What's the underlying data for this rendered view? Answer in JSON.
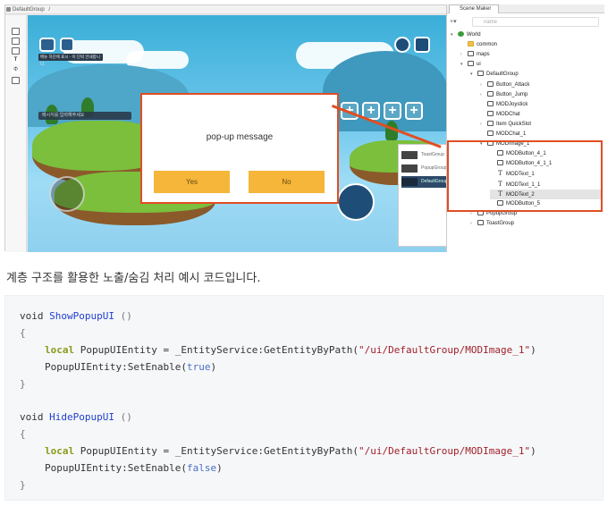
{
  "editor": {
    "tab_title": "DefaultGroup",
    "tab_separator": "/",
    "tool_icons": [
      "select-icon",
      "ui-frame-icon",
      "image-icon",
      "text-icon",
      "joystick-icon",
      "grid-icon"
    ],
    "tool_glyphs": {
      "text": "T",
      "joystick": "Φ"
    }
  },
  "game": {
    "tip_text": "메뉴 하단에 표시 - 이 단락 안내합니다.",
    "chat_placeholder": "메시지를 입력해주세요",
    "popup": {
      "message": "pop-up message",
      "yes_label": "Yes",
      "no_label": "No"
    },
    "plus_glyph": "+",
    "toast_panel": [
      {
        "label": "ToastGroup"
      },
      {
        "label": "PopupGroup"
      },
      {
        "label": "DefaultGroup"
      }
    ]
  },
  "scene_maker": {
    "title": "Scene Maker",
    "search_placeholder": "name",
    "tree": [
      {
        "label": "World",
        "depth": 0,
        "arrow": "▾",
        "icon": "world"
      },
      {
        "label": "common",
        "depth": 1,
        "arrow": "",
        "icon": "folder"
      },
      {
        "label": "maps",
        "depth": 1,
        "arrow": "›",
        "icon": "maps"
      },
      {
        "label": "ui",
        "depth": 1,
        "arrow": "▾",
        "icon": "ui"
      },
      {
        "label": "DefaultGroup",
        "depth": 2,
        "arrow": "▾",
        "icon": "group"
      },
      {
        "label": "Button_Attack",
        "depth": 3,
        "arrow": "›",
        "icon": "box"
      },
      {
        "label": "Button_Jump",
        "depth": 3,
        "arrow": "›",
        "icon": "box"
      },
      {
        "label": "MODJoystick",
        "depth": 3,
        "arrow": "",
        "icon": "box"
      },
      {
        "label": "MODChat",
        "depth": 3,
        "arrow": "",
        "icon": "box"
      },
      {
        "label": "Item QuickSlot",
        "depth": 3,
        "arrow": "›",
        "icon": "box"
      },
      {
        "label": "MODChat_1",
        "depth": 3,
        "arrow": "",
        "icon": "box"
      },
      {
        "label": "MODImage_1",
        "depth": 3,
        "arrow": "▾",
        "icon": "box"
      },
      {
        "label": "MODButton_4_1",
        "depth": 4,
        "arrow": "",
        "icon": "box"
      },
      {
        "label": "MODButton_4_1_1",
        "depth": 4,
        "arrow": "",
        "icon": "box"
      },
      {
        "label": "MODText_1",
        "depth": 4,
        "arrow": "",
        "icon": "text"
      },
      {
        "label": "MODText_1_1",
        "depth": 4,
        "arrow": "",
        "icon": "text"
      },
      {
        "label": "MODText_2",
        "depth": 4,
        "arrow": "",
        "icon": "text",
        "highlighted": true
      },
      {
        "label": "MODButton_5",
        "depth": 4,
        "arrow": "",
        "icon": "box"
      },
      {
        "label": "PopupGroup",
        "depth": 2,
        "arrow": "›",
        "icon": "group"
      },
      {
        "label": "ToastGroup",
        "depth": 2,
        "arrow": "›",
        "icon": "group"
      }
    ]
  },
  "caption": "계층 구조를 활용한 노출/숨김 처리 예시 코드입니다.",
  "code": {
    "show_void": "void",
    "show_name": "ShowPopupUI",
    "show_parens": "()",
    "open1": "{",
    "local1": "local",
    "decl1_pre": "PopupUIEntity = _EntityService:GetEntityByPath(",
    "path1": "\"/ui/DefaultGroup/MODImage_1\"",
    "decl1_post": ")",
    "call1_pre": "PopupUIEntity:SetEnable(",
    "val_true": "true",
    "call1_post": ")",
    "close1": "}",
    "hide_void": "void",
    "hide_name": "HidePopupUI",
    "hide_parens": "()",
    "open2": "{",
    "local2": "local",
    "decl2_pre": "PopupUIEntity = _EntityService:GetEntityByPath(",
    "path2": "\"/ui/DefaultGroup/MODImage_1\"",
    "decl2_post": ")",
    "call2_pre": "PopupUIEntity:SetEnable(",
    "val_false": "false",
    "call2_post": ")",
    "close2": "}"
  },
  "colors": {
    "highlight": "#e04e22",
    "popup_button": "#f5b63a",
    "keyword": "#8a9a1a",
    "function_name": "#1f3fcf",
    "string": "#a1212a",
    "boolean": "#4a6fc4"
  }
}
